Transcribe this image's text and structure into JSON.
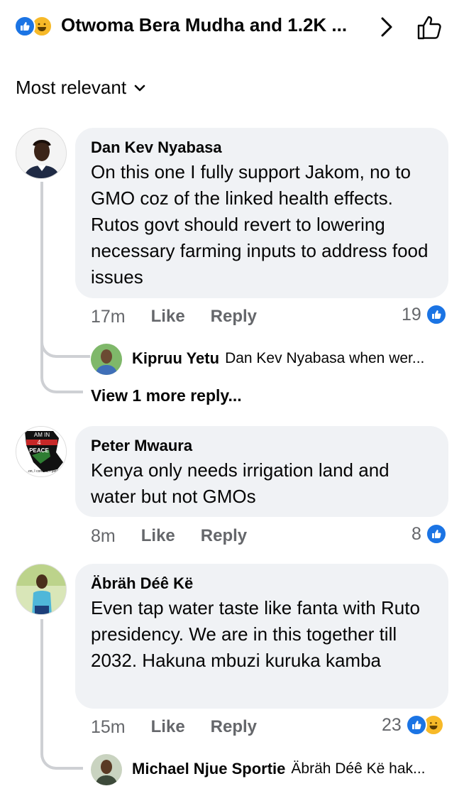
{
  "header": {
    "title": "Otwoma Bera Mudha and 1.2K ...",
    "reactions": [
      "like-icon",
      "haha-icon"
    ]
  },
  "sort": {
    "label": "Most relevant"
  },
  "colors": {
    "accent": "#1b74e4",
    "bubble": "#f0f2f5",
    "meta": "#65676b",
    "haha": "#f7b928"
  },
  "comments": [
    {
      "author": "Dan Kev Nyabasa",
      "text": "On this one I fully support Jakom, no to GMO coz of the linked health effects. Rutos govt should revert to lowering necessary farming inputs to address food issues",
      "time": "17m",
      "like": "Like",
      "reply": "Reply",
      "reactions": "19",
      "reply_preview": {
        "name": "Kipruu Yetu",
        "snippet": "Dan Kev Nyabasa when wer..."
      },
      "view_more": "View 1 more reply..."
    },
    {
      "author": "Peter Mwaura",
      "text": "Kenya only needs irrigation land and water but not GMOs",
      "time": "8m",
      "like": "Like",
      "reply": "Reply",
      "reactions": "8",
      "avatar_text": {
        "line1": "AM IN",
        "line2": "4",
        "line3": "PEACE",
        "line4": "...on, I commit, I pled"
      }
    },
    {
      "author": "Äbräh Déê Kë",
      "text": "Even tap water taste like fanta with Ruto presidency. We are in this together till 2032. Hakuna mbuzi kuruka kamba",
      "time": "15m",
      "like": "Like",
      "reply": "Reply",
      "reactions": "23",
      "reply_preview": {
        "name": "Michael Njue Sportie",
        "snippet": "Äbräh Déê Kë hak..."
      }
    }
  ]
}
